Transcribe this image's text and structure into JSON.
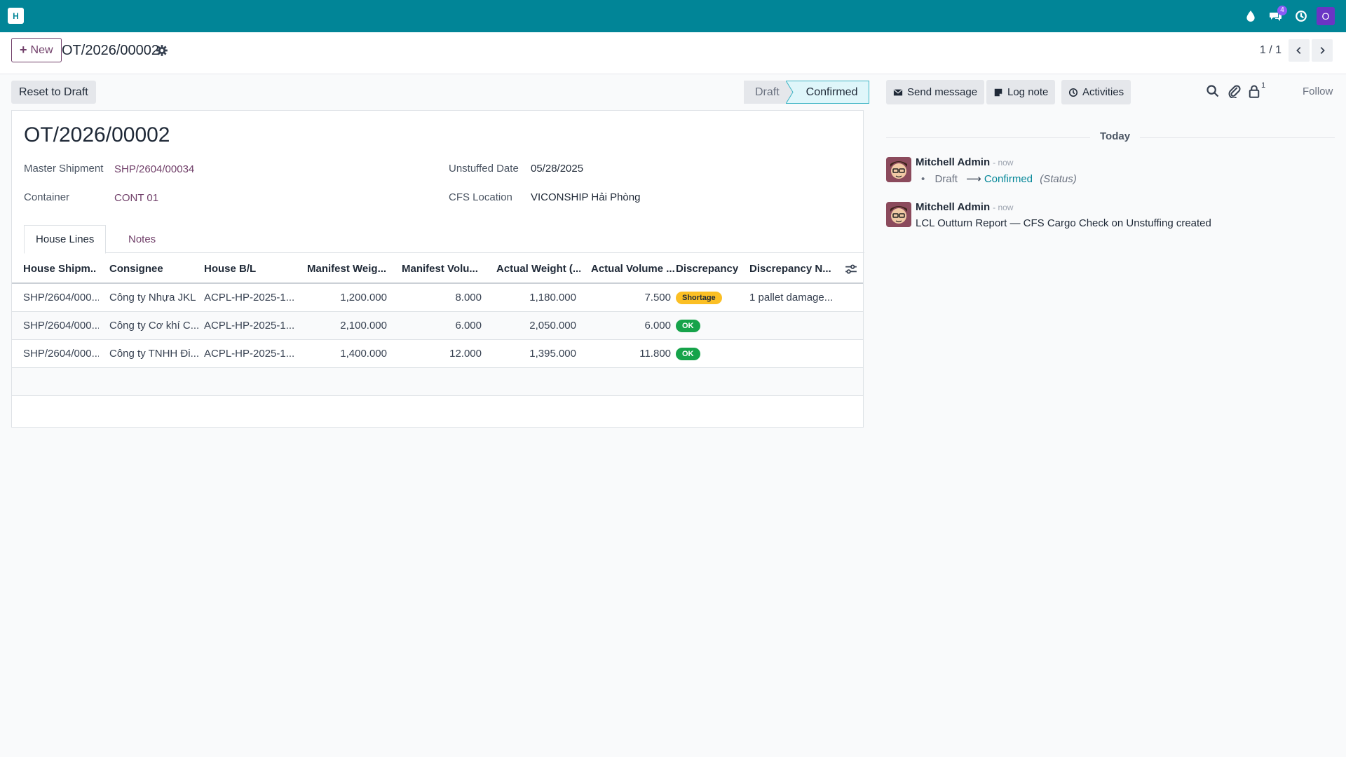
{
  "app": {
    "logo_letter": "H",
    "user_initial": "O"
  },
  "topbar": {
    "messages_badge": "4"
  },
  "control": {
    "new_label": "New",
    "breadcrumb_title": "OT/2026/00002",
    "pager": "1 / 1"
  },
  "actions": {
    "reset_label": "Reset to Draft"
  },
  "statusbar": {
    "stages": [
      "Draft",
      "Confirmed"
    ],
    "current": "Confirmed"
  },
  "record": {
    "title": "OT/2026/00002",
    "fields": {
      "master_shipment": {
        "label": "Master Shipment",
        "value": "SHP/2604/00034"
      },
      "container": {
        "label": "Container",
        "value": "CONT 01"
      },
      "unstuffed_date": {
        "label": "Unstuffed Date",
        "value": "05/28/2025"
      },
      "cfs_location": {
        "label": "CFS Location",
        "value": "VICONSHIP Hải Phòng"
      }
    },
    "tabs": [
      "House Lines",
      "Notes"
    ]
  },
  "table": {
    "headers": [
      "House Shipm...",
      "Consignee",
      "House B/L",
      "Manifest Weig...",
      "Manifest Volu...",
      "Actual Weight (...",
      "Actual Volume ...",
      "Discrepancy",
      "Discrepancy N..."
    ],
    "rows": [
      {
        "house_shipment": "SHP/2604/000...",
        "consignee": "Công ty Nhựa JKL",
        "house_bl": "ACPL-HP-2025-1...",
        "manifest_weight": "1,200.000",
        "manifest_volume": "8.000",
        "actual_weight": "1,180.000",
        "actual_volume": "7.500",
        "discrepancy": "Shortage",
        "discrepancy_note": "1 pallet damage..."
      },
      {
        "house_shipment": "SHP/2604/000...",
        "consignee": "Công ty Cơ khí C...",
        "house_bl": "ACPL-HP-2025-1...",
        "manifest_weight": "2,100.000",
        "manifest_volume": "6.000",
        "actual_weight": "2,050.000",
        "actual_volume": "6.000",
        "discrepancy": "OK",
        "discrepancy_note": ""
      },
      {
        "house_shipment": "SHP/2604/000...",
        "consignee": "Công ty TNHH Đi...",
        "house_bl": "ACPL-HP-2025-1...",
        "manifest_weight": "1,400.000",
        "manifest_volume": "12.000",
        "actual_weight": "1,395.000",
        "actual_volume": "11.800",
        "discrepancy": "OK",
        "discrepancy_note": ""
      }
    ]
  },
  "chatter": {
    "send_message_label": "Send message",
    "log_note_label": "Log note",
    "activities_label": "Activities",
    "followers_count": "1",
    "follow_label": "Follow",
    "date_separator": "Today",
    "messages": [
      {
        "author": "Mitchell Admin",
        "time": "- now",
        "from_status": "Draft",
        "to_status": "Confirmed",
        "field": "(Status)"
      },
      {
        "author": "Mitchell Admin",
        "time": "- now",
        "body": "LCL Outturn Report — CFS Cargo Check on Unstuffing created"
      }
    ]
  },
  "colors": {
    "navbar": "#018597",
    "brand": "#71406a",
    "shortage": "#fbbf24",
    "ok": "#16a34a"
  }
}
